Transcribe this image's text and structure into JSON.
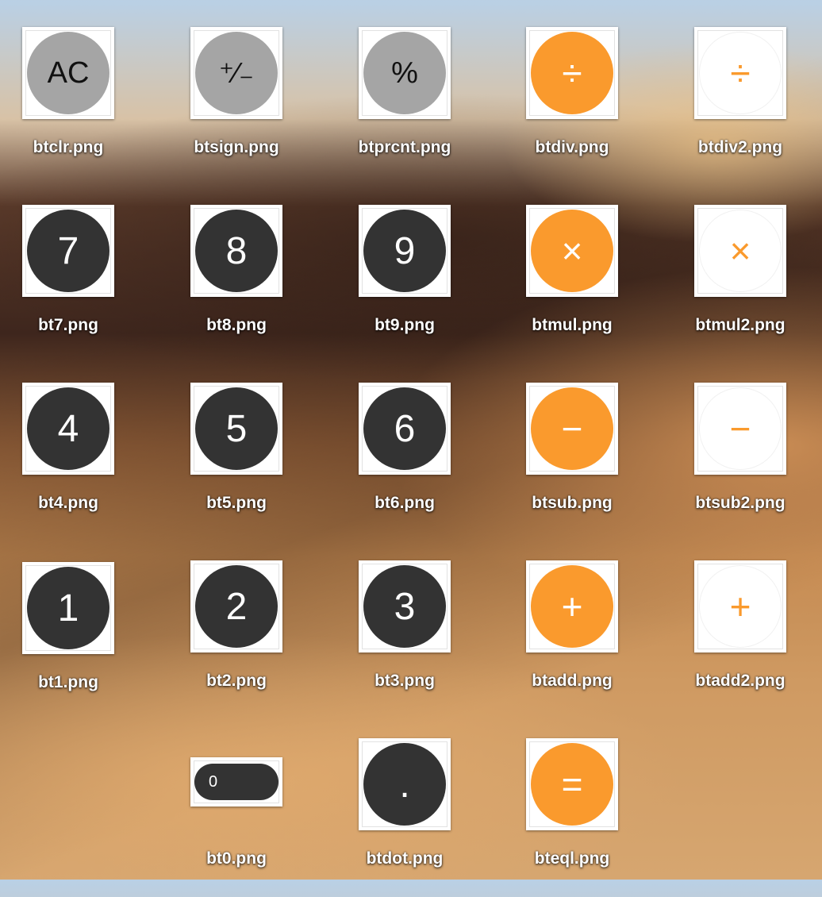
{
  "desktop": {
    "files": [
      {
        "id": "btclr",
        "filename": "btclr.png",
        "symbol": "AC",
        "style": "gray"
      },
      {
        "id": "btsign",
        "filename": "btsign.png",
        "symbol": "⁺⁄₋",
        "style": "gray"
      },
      {
        "id": "btprcnt",
        "filename": "btprcnt.png",
        "symbol": "%",
        "style": "gray"
      },
      {
        "id": "btdiv",
        "filename": "btdiv.png",
        "symbol": "÷",
        "style": "orange"
      },
      {
        "id": "btdiv2",
        "filename": "btdiv2.png",
        "symbol": "÷",
        "style": "white"
      },
      {
        "id": "bt7",
        "filename": "bt7.png",
        "symbol": "7",
        "style": "dark"
      },
      {
        "id": "bt8",
        "filename": "bt8.png",
        "symbol": "8",
        "style": "dark"
      },
      {
        "id": "bt9",
        "filename": "bt9.png",
        "symbol": "9",
        "style": "dark"
      },
      {
        "id": "btmul",
        "filename": "btmul.png",
        "symbol": "×",
        "style": "orange"
      },
      {
        "id": "btmul2",
        "filename": "btmul2.png",
        "symbol": "×",
        "style": "white"
      },
      {
        "id": "bt4",
        "filename": "bt4.png",
        "symbol": "4",
        "style": "dark"
      },
      {
        "id": "bt5",
        "filename": "bt5.png",
        "symbol": "5",
        "style": "dark"
      },
      {
        "id": "bt6",
        "filename": "bt6.png",
        "symbol": "6",
        "style": "dark"
      },
      {
        "id": "btsub",
        "filename": "btsub.png",
        "symbol": "−",
        "style": "orange"
      },
      {
        "id": "btsub2",
        "filename": "btsub2.png",
        "symbol": "−",
        "style": "white"
      },
      {
        "id": "bt1",
        "filename": "bt1.png",
        "symbol": "1",
        "style": "dark"
      },
      {
        "id": "bt2",
        "filename": "bt2.png",
        "symbol": "2",
        "style": "dark"
      },
      {
        "id": "bt3",
        "filename": "bt3.png",
        "symbol": "3",
        "style": "dark"
      },
      {
        "id": "btadd",
        "filename": "btadd.png",
        "symbol": "+",
        "style": "orange"
      },
      {
        "id": "btadd2",
        "filename": "btadd2.png",
        "symbol": "+",
        "style": "white"
      },
      {
        "id": "bt0",
        "filename": "bt0.png",
        "symbol": "0",
        "style": "pill"
      },
      {
        "id": "btdot",
        "filename": "btdot.png",
        "symbol": ".",
        "style": "dark"
      },
      {
        "id": "bteql",
        "filename": "bteql.png",
        "symbol": "=",
        "style": "orange"
      }
    ]
  },
  "colors": {
    "calculator_orange": "#fa9a2d",
    "function_gray": "#a5a5a5",
    "digit_dark": "#333333"
  }
}
